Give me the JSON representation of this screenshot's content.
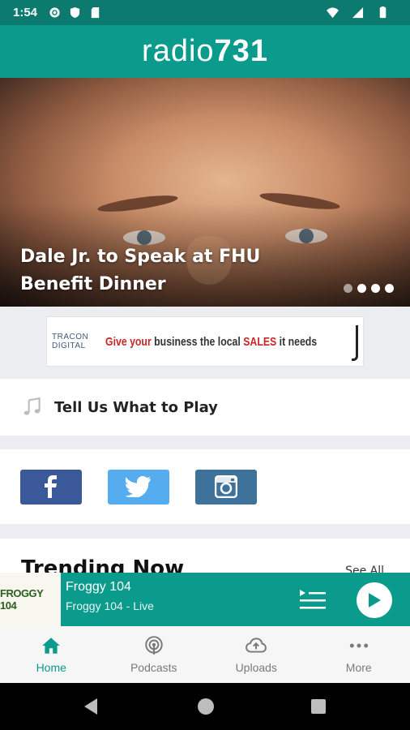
{
  "status_bar": {
    "time": "1:54",
    "icons": [
      "gear-icon",
      "shield-icon",
      "sd-card-icon",
      "wifi-icon",
      "signal-icon",
      "battery-icon"
    ]
  },
  "header": {
    "logo_text": "radio",
    "logo_number": "731",
    "brand_color": "#0a9b8c"
  },
  "hero": {
    "headline": "Dale Jr. to Speak at FHU Benefit Dinner",
    "slide_count": 4,
    "active_slide": 2
  },
  "ad": {
    "brand": "TRACON DIGITAL",
    "text_part1": "Give your",
    "text_part2": "business the local",
    "text_part3": "SALES",
    "text_part4": "it needs"
  },
  "request_card": {
    "icon": "music-note-icon",
    "label": "Tell Us What to Play"
  },
  "social": {
    "facebook_color": "#3b5998",
    "twitter_color": "#55acee",
    "instagram_color": "#3f729b"
  },
  "trending": {
    "title": "Trending Now",
    "see_all": "See All"
  },
  "player": {
    "station_logo_text": "FROGGY 104",
    "title": "Froggy 104",
    "subtitle": "Froggy 104 - Live"
  },
  "bottom_nav": {
    "items": [
      {
        "label": "Home",
        "icon": "home-icon",
        "active": true
      },
      {
        "label": "Podcasts",
        "icon": "podcast-icon",
        "active": false
      },
      {
        "label": "Uploads",
        "icon": "cloud-upload-icon",
        "active": false
      },
      {
        "label": "More",
        "icon": "more-dots-icon",
        "active": false
      }
    ]
  }
}
